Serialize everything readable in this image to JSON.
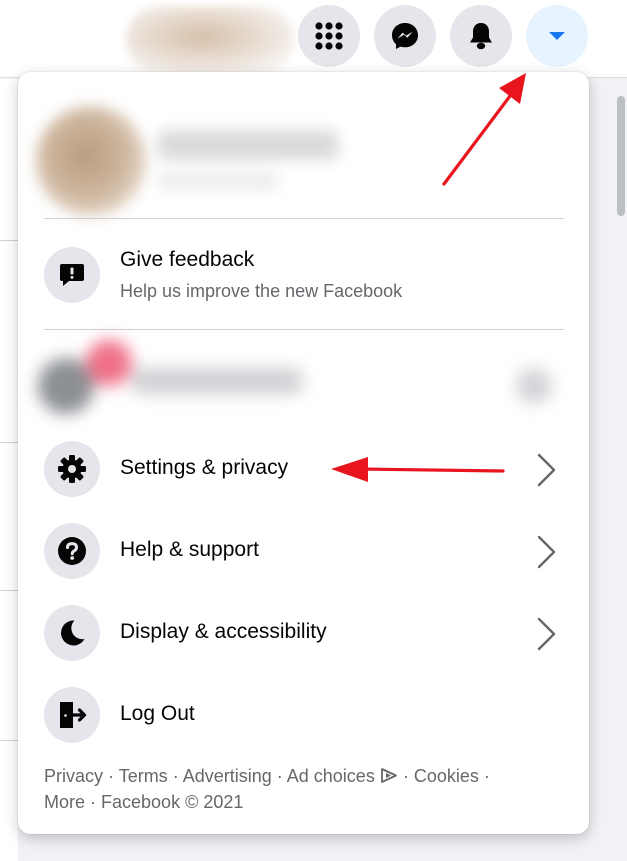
{
  "topbar": {
    "icons": [
      "menu-grid-icon",
      "messenger-icon",
      "bell-icon",
      "caret-down-icon"
    ],
    "accent": "#1877f2"
  },
  "menu": {
    "feedback": {
      "title": "Give feedback",
      "subtitle": "Help us improve the new Facebook",
      "icon": "feedback-icon"
    },
    "items": [
      {
        "label": "Settings & privacy",
        "icon": "gear-icon",
        "has_submenu": true
      },
      {
        "label": "Help & support",
        "icon": "question-icon",
        "has_submenu": true
      },
      {
        "label": "Display & accessibility",
        "icon": "moon-icon",
        "has_submenu": true
      },
      {
        "label": "Log Out",
        "icon": "logout-icon",
        "has_submenu": false
      }
    ]
  },
  "footer": {
    "privacy": "Privacy",
    "terms": "Terms",
    "advertising": "Advertising",
    "ad_choices": "Ad choices",
    "cookies": "Cookies",
    "more": "More",
    "copyright": "Facebook © 2021",
    "separator": " · "
  },
  "annotation_color": "#e8141e"
}
